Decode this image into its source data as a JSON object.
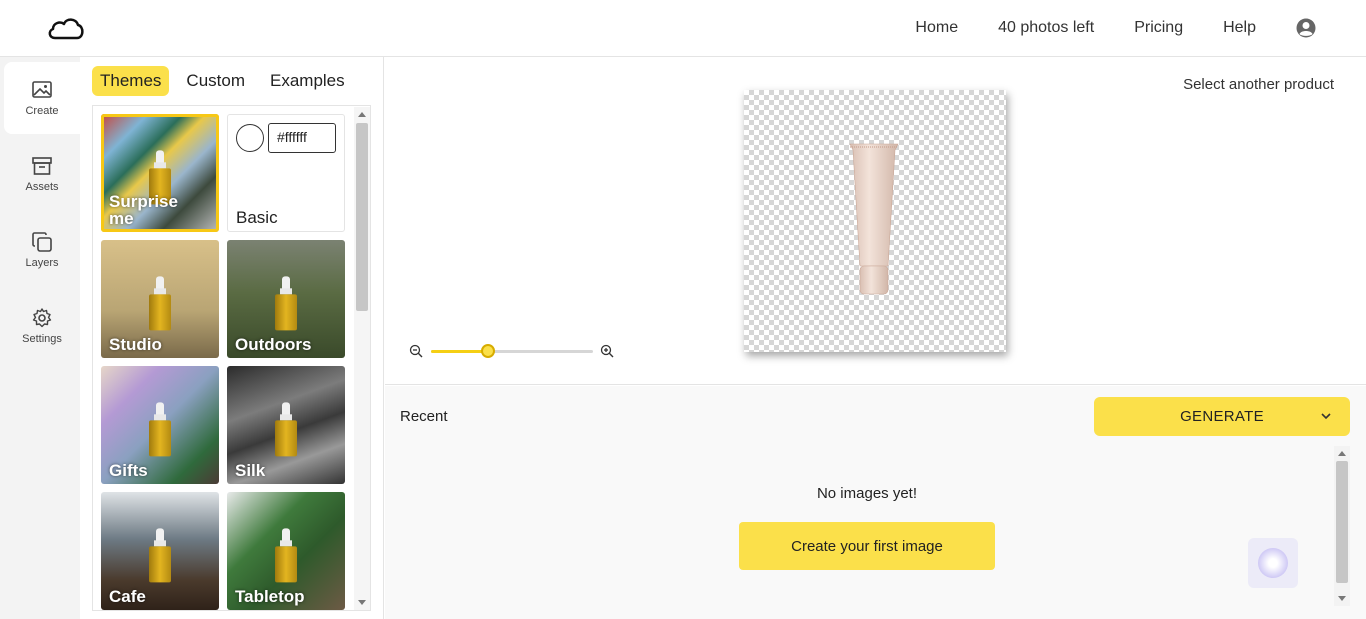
{
  "header": {
    "nav": {
      "home": "Home",
      "photos_left": "40 photos left",
      "pricing": "Pricing",
      "help": "Help"
    }
  },
  "rail": {
    "create": "Create",
    "assets": "Assets",
    "layers": "Layers",
    "settings": "Settings"
  },
  "panel": {
    "tabs": [
      "Themes",
      "Custom",
      "Examples"
    ],
    "basic": {
      "label": "Basic",
      "hex_value": "#ffffff"
    },
    "themes": [
      {
        "label": "Surprise me"
      },
      {
        "label": "Studio"
      },
      {
        "label": "Outdoors"
      },
      {
        "label": "Gifts"
      },
      {
        "label": "Silk"
      },
      {
        "label": "Cafe"
      },
      {
        "label": "Tabletop"
      }
    ]
  },
  "preview": {
    "select_product": "Select another product",
    "zoom_level": 0.35
  },
  "recent": {
    "title": "Recent",
    "generate_label": "GENERATE",
    "empty_text": "No images yet!",
    "create_first_label": "Create your first image"
  },
  "colors": {
    "accent": "#fbe04a",
    "selected_outline": "#f7c815"
  }
}
